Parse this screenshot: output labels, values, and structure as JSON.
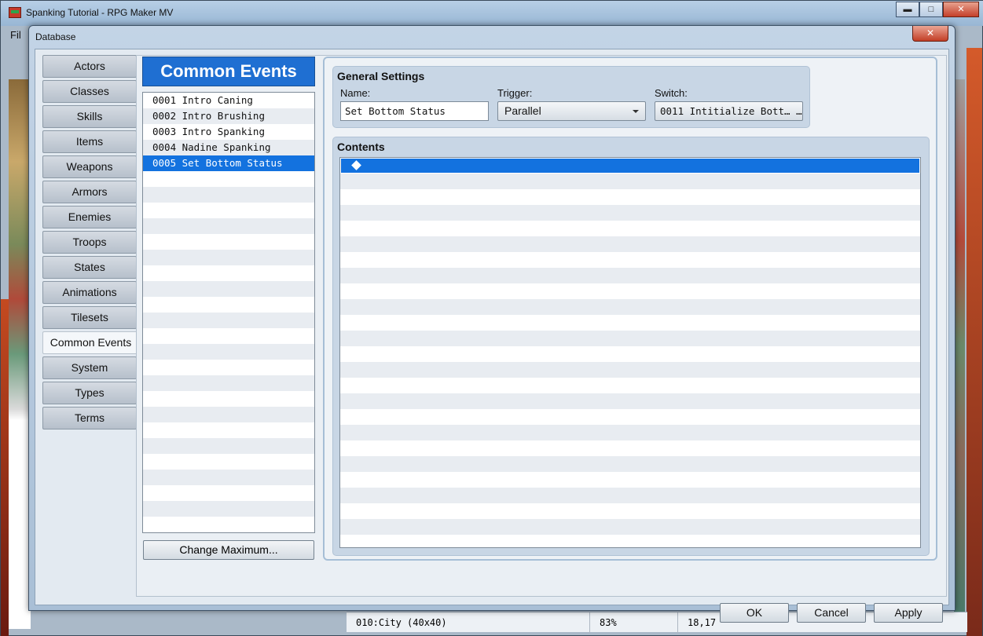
{
  "app": {
    "title": "Spanking Tutorial - RPG Maker MV",
    "menu_first": "Fil",
    "window_buttons": {
      "minimize": "▬",
      "maximize": "□",
      "close": "✕"
    }
  },
  "statusbar": {
    "map": "010:City (40x40)",
    "zoom": "83%",
    "coords": "18,17"
  },
  "dialog": {
    "title": "Database",
    "close_glyph": "✕"
  },
  "tabs": [
    {
      "label": "Actors"
    },
    {
      "label": "Classes"
    },
    {
      "label": "Skills"
    },
    {
      "label": "Items"
    },
    {
      "label": "Weapons"
    },
    {
      "label": "Armors"
    },
    {
      "label": "Enemies"
    },
    {
      "label": "Troops"
    },
    {
      "label": "States"
    },
    {
      "label": "Animations"
    },
    {
      "label": "Tilesets"
    },
    {
      "label": "Common Events",
      "active": true
    },
    {
      "label": "System"
    },
    {
      "label": "Types"
    },
    {
      "label": "Terms"
    }
  ],
  "list": {
    "header": "Common Events",
    "items": [
      "0001 Intro Caning",
      "0002 Intro Brushing",
      "0003 Intro Spanking",
      "0004 Nadine Spanking",
      "0005 Set Bottom Status"
    ],
    "selected_index": 4,
    "change_max_label": "Change Maximum..."
  },
  "general": {
    "title": "General Settings",
    "name_label": "Name:",
    "name_value": "Set Bottom Status",
    "trigger_label": "Trigger:",
    "trigger_value": "Parallel",
    "switch_label": "Switch:",
    "switch_value": "0011 Intitialize Bott… …"
  },
  "contents": {
    "title": "Contents"
  },
  "footer": {
    "ok": "OK",
    "cancel": "Cancel",
    "apply": "Apply"
  },
  "colors": {
    "accent": "#1372df",
    "header_blue": "#1f6fd2"
  }
}
